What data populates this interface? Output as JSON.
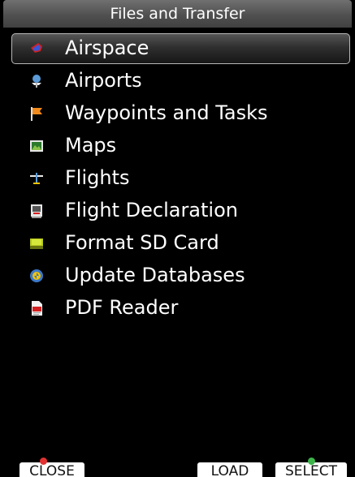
{
  "title": "Files and Transfer",
  "menu": {
    "selected_index": 0,
    "items": [
      {
        "label": "Airspace",
        "icon": "airspace-icon"
      },
      {
        "label": "Airports",
        "icon": "airport-icon"
      },
      {
        "label": "Waypoints and Tasks",
        "icon": "waypoint-flag-icon"
      },
      {
        "label": "Maps",
        "icon": "map-icon"
      },
      {
        "label": "Flights",
        "icon": "glider-icon"
      },
      {
        "label": "Flight Declaration",
        "icon": "declaration-icon"
      },
      {
        "label": "Format SD Card",
        "icon": "sd-card-icon"
      },
      {
        "label": "Update Databases",
        "icon": "update-icon"
      },
      {
        "label": "PDF Reader",
        "icon": "pdf-icon"
      }
    ]
  },
  "buttons": {
    "close": {
      "label": "CLOSE",
      "badge": "red-x-badge"
    },
    "load": {
      "label": "LOAD"
    },
    "select": {
      "label": "SELECT",
      "badge": "green-check-badge"
    }
  },
  "colors": {
    "background": "#000000",
    "text": "#ffffff",
    "close_badge": "#e23232",
    "select_badge": "#3bb54a"
  }
}
